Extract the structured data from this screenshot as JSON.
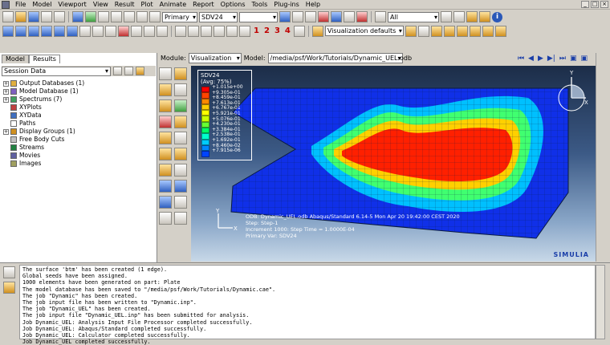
{
  "menu": [
    "File",
    "Model",
    "Viewport",
    "View",
    "Result",
    "Plot",
    "Animate",
    "Report",
    "Options",
    "Tools",
    "Plug-ins",
    "Help"
  ],
  "toolbar": {
    "step_combo": "Primary",
    "variable_combo": "SDV24",
    "selection_combo": "All",
    "viz_defaults": "Visualization defaults",
    "numbers": [
      "1",
      "2",
      "3",
      "4"
    ]
  },
  "tabs": [
    "Model",
    "Results"
  ],
  "session": {
    "label": "Session Data"
  },
  "tree": [
    {
      "label": "Output Databases (1)",
      "expander": "+",
      "color": "#e0b040"
    },
    {
      "label": "Model Database (1)",
      "expander": "+",
      "color": "#8060c0"
    },
    {
      "label": "Spectrums (7)",
      "expander": "+",
      "color": "#40a060"
    },
    {
      "label": "XYPlots",
      "expander": "",
      "color": "#c04040"
    },
    {
      "label": "XYData",
      "expander": "",
      "color": "#4070c0"
    },
    {
      "label": "Paths",
      "expander": "",
      "color": "#ffffff"
    },
    {
      "label": "Display Groups (1)",
      "expander": "+",
      "color": "#d09020"
    },
    {
      "label": "Free Body Cuts",
      "expander": "",
      "color": "#c0c0c0"
    },
    {
      "label": "Streams",
      "expander": "",
      "color": "#208040"
    },
    {
      "label": "Movies",
      "expander": "",
      "color": "#6060a0"
    },
    {
      "label": "Images",
      "expander": "",
      "color": "#a0a060"
    }
  ],
  "module": {
    "module_label": "Module:",
    "module_value": "Visualization",
    "model_label": "Model:",
    "model_value": "/media/psf/Work/Tutorials/Dynamic_UEL.odb"
  },
  "legend": {
    "title": "SDV24",
    "subtitle": "(Avg: 75%)",
    "values": [
      "+1.015e+00",
      "+9.305e-01",
      "+8.459e-01",
      "+7.613e-01",
      "+6.767e-01",
      "+5.921e-01",
      "+5.076e-01",
      "+4.230e-01",
      "+3.384e-01",
      "+2.538e-01",
      "+1.692e-01",
      "+8.460e-02",
      "+7.915e-06"
    ],
    "colors": [
      "#ff0000",
      "#ff4400",
      "#ff8800",
      "#ffcc00",
      "#ffff00",
      "#ccff00",
      "#66ff33",
      "#00ff66",
      "#00ffcc",
      "#00ccff",
      "#0088ff",
      "#0044ff",
      "#0000ff"
    ]
  },
  "viewport_info": {
    "line1": "ODB: Dynamic_UEL.odb    Abaqus/Standard 6.14-5    Mon Apr 20 19:42:00 CEST 2020",
    "line2": "Step: Step-1",
    "line3": "Increment   1000: Step Time =     1.0000E-04",
    "line4": "Primary Var: SDV24"
  },
  "axis": {
    "x": "X",
    "y": "Y"
  },
  "brand": "SIMULIA",
  "messages": [
    "The surface 'btm' has been created (1 edge).",
    "Global seeds have been assigned.",
    "1000 elements have been generated on part: Plate",
    "The model database has been saved to \"/media/psf/Work/Tutorials/Dynamic.cae\".",
    "The job \"Dynamic\" has been created.",
    "The job input file has been written to \"Dynamic.inp\".",
    "The job \"Dynamic_UEL\" has been created.",
    "The job input file \"Dynamic_UEL.inp\" has been submitted for analysis.",
    "Job Dynamic_UEL: Analysis Input File Processor completed successfully.",
    "Job Dynamic_UEL: Abaqus/Standard completed successfully.",
    "Job Dynamic_UEL: Calculator completed successfully.",
    "Job Dynamic_UEL completed successfully."
  ]
}
